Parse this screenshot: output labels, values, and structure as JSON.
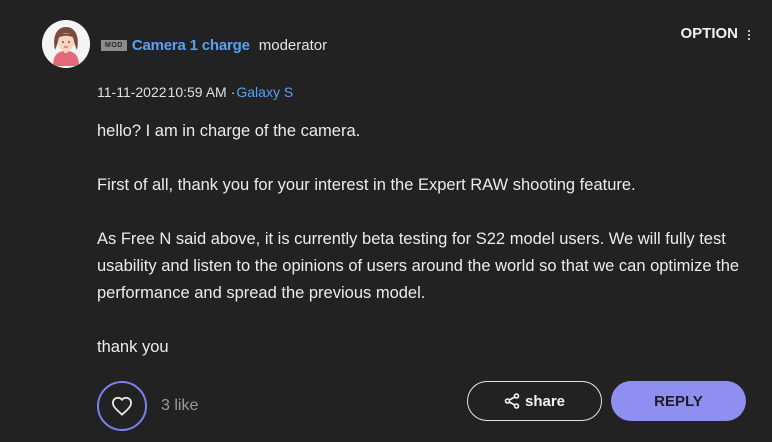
{
  "author": {
    "avatar_icon": "female-avatar-icon",
    "badge": "MOD",
    "name": "Camera 1 charge",
    "role": "moderator"
  },
  "option_menu": {
    "label": "OPTION",
    "icon": "vertical-dots-icon"
  },
  "meta": {
    "date": "11-11-2022",
    "time": "10:59 AM",
    "separator": "·",
    "device": "Galaxy S"
  },
  "message": {
    "paragraphs": [
      "hello? I am in charge of the camera.",
      "First of all, thank you for your interest in the Expert RAW shooting feature.",
      "As Free N said above, it is currently beta testing for S22 model users. We will fully test usability and listen to the opinions of users around the world so that we can optimize the performance and spread the previous model.",
      "thank you"
    ]
  },
  "actions": {
    "like_icon": "heart-icon",
    "like_count": "3 like",
    "share_icon": "share-icon",
    "share_label": "share",
    "reply_label": "REPLY"
  },
  "colors": {
    "background": "#222222",
    "link": "#5aa0f2",
    "accent": "#8f8ff2"
  }
}
